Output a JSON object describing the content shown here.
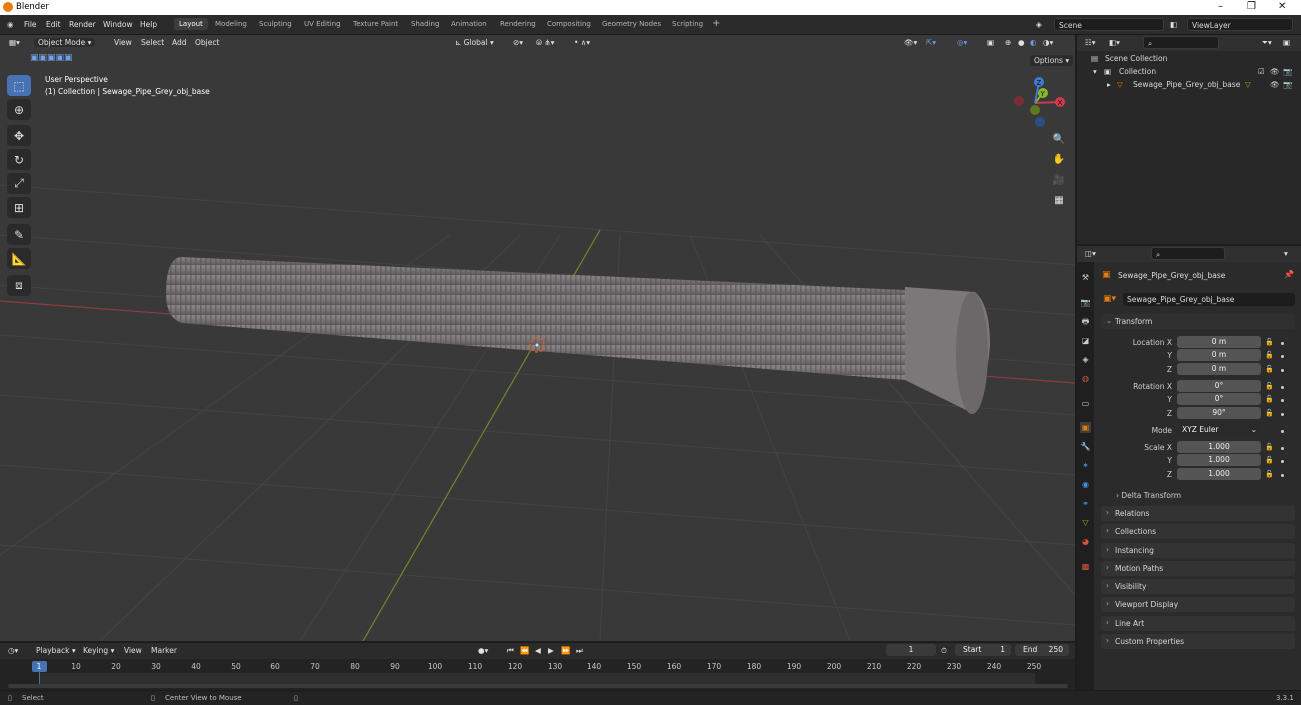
{
  "titlebar": {
    "title": "Blender"
  },
  "menu": [
    "File",
    "Edit",
    "Render",
    "Window",
    "Help"
  ],
  "workspaces": [
    "Layout",
    "Modeling",
    "Sculpting",
    "UV Editing",
    "Texture Paint",
    "Shading",
    "Animation",
    "Rendering",
    "Compositing",
    "Geometry Nodes",
    "Scripting"
  ],
  "active_workspace": "Layout",
  "scene": {
    "name": "Scene"
  },
  "view_layer": {
    "name": "ViewLayer"
  },
  "viewport_header": {
    "mode": "Object Mode",
    "menus": [
      "View",
      "Select",
      "Add",
      "Object"
    ],
    "orientation": "Global",
    "options": "Options"
  },
  "viewport": {
    "perspective": "User Perspective",
    "collection_info": "(1) Collection | Sewage_Pipe_Grey_obj_base",
    "gizmo": {
      "x": "X",
      "y": "Y",
      "z": "Z"
    }
  },
  "outliner": {
    "root": "Scene Collection",
    "collection": "Collection",
    "object": "Sewage_Pipe_Grey_obj_base"
  },
  "properties": {
    "object_name": "Sewage_Pipe_Grey_obj_base",
    "object_field": "Sewage_Pipe_Grey_obj_base",
    "transform_title": "Transform",
    "location": {
      "label": "Location X",
      "y_label": "Y",
      "z_label": "Z",
      "x": "0 m",
      "y": "0 m",
      "z": "0 m"
    },
    "rotation": {
      "label": "Rotation X",
      "y_label": "Y",
      "z_label": "Z",
      "x": "0°",
      "y": "0°",
      "z": "90°"
    },
    "mode": {
      "label": "Mode",
      "value": "XYZ Euler"
    },
    "scale": {
      "label": "Scale X",
      "y_label": "Y",
      "z_label": "Z",
      "x": "1.000",
      "y": "1.000",
      "z": "1.000"
    },
    "delta": "Delta Transform",
    "panels": [
      "Relations",
      "Collections",
      "Instancing",
      "Motion Paths",
      "Visibility",
      "Viewport Display",
      "Line Art",
      "Custom Properties"
    ]
  },
  "timeline": {
    "menus": [
      "Playback",
      "Keying",
      "View",
      "Marker"
    ],
    "current_frame": "1",
    "start_label": "Start",
    "start": "1",
    "end_label": "End",
    "end": "250",
    "ticks": [
      "1",
      "10",
      "20",
      "30",
      "40",
      "50",
      "60",
      "70",
      "80",
      "90",
      "100",
      "110",
      "120",
      "130",
      "140",
      "150",
      "160",
      "170",
      "180",
      "190",
      "200",
      "210",
      "220",
      "230",
      "240",
      "250"
    ]
  },
  "statusbar": {
    "select": "Select",
    "center_view": "Center View to Mouse",
    "version": "3.3.1"
  },
  "colors": {
    "accent": "#4772b3",
    "x_axis": "#d03a4d",
    "y_axis": "#8ab629",
    "z_axis": "#3d7bd5",
    "object_orange": "#e87d0d"
  }
}
